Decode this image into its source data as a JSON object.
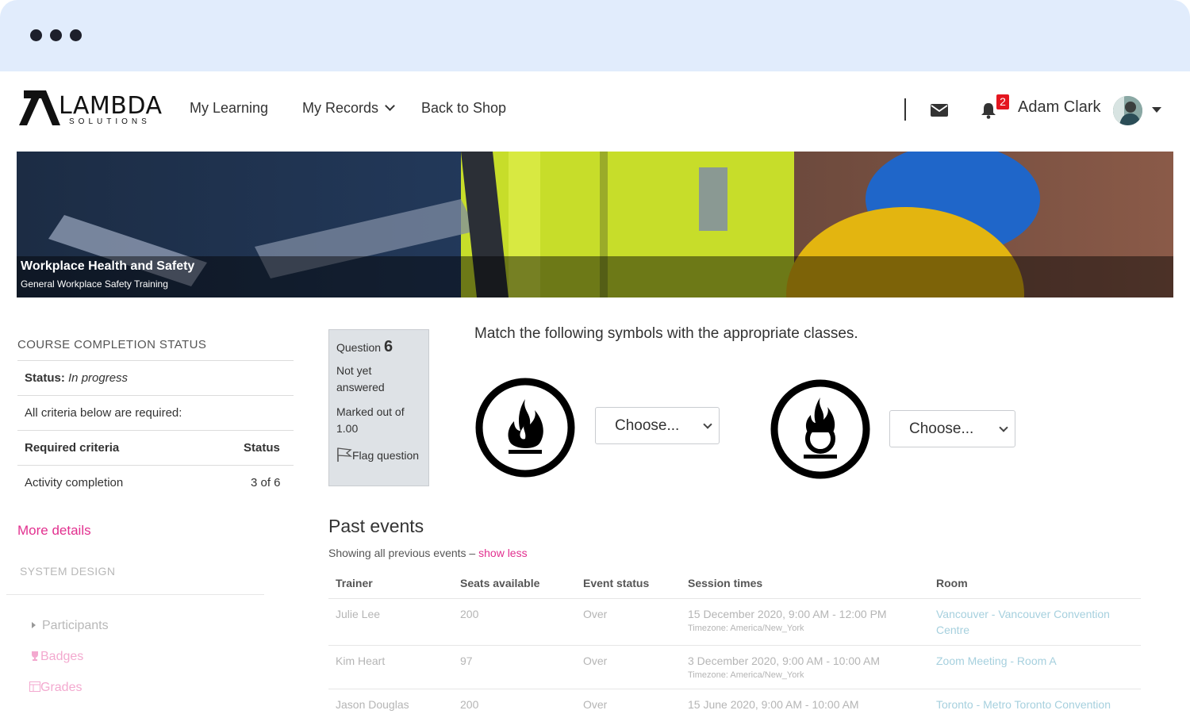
{
  "brand": {
    "word": "LAMBDA",
    "sub": "SOLUTIONS"
  },
  "nav": {
    "my_learning": "My Learning",
    "my_records": "My Records",
    "back_to_shop": "Back to Shop",
    "notification_count": "2",
    "user_name": "Adam Clark"
  },
  "banner": {
    "title": "Workplace Health and Safety",
    "subtitle": "General Workplace Safety Training"
  },
  "completion": {
    "heading": "COURSE COMPLETION STATUS",
    "status_label": "Status:",
    "status_value": "In progress",
    "criteria_note": "All criteria below are required:",
    "col_criteria": "Required criteria",
    "col_status": "Status",
    "row_label": "Activity completion",
    "row_value": "3 of 6",
    "more_details": "More details"
  },
  "sidebar": {
    "section": "SYSTEM DESIGN",
    "items": [
      {
        "label": "Participants",
        "icon": "triangle-right-icon"
      },
      {
        "label": "Badges",
        "icon": "trophy-icon"
      },
      {
        "label": "Grades",
        "icon": "table-icon"
      }
    ]
  },
  "question": {
    "label": "Question",
    "number": "6",
    "state": "Not yet answered",
    "marks": "Marked out of 1.00",
    "flag": "Flag question",
    "prompt": "Match the following symbols with the appropriate classes.",
    "select_1": "Choose...",
    "select_2": "Choose..."
  },
  "events": {
    "title": "Past events",
    "sub_text": "Showing all previous events –",
    "toggle": "show less",
    "columns": [
      "Trainer",
      "Seats available",
      "Event status",
      "Session times",
      "Room"
    ],
    "rows": [
      {
        "trainer": "Julie Lee",
        "seats": "200",
        "status": "Over",
        "time": "15 December 2020, 9:00 AM - 12:00 PM",
        "tz": "Timezone: America/New_York",
        "room_line1": "Vancouver - Vancouver Convention",
        "room_line2": "Centre"
      },
      {
        "trainer": "Kim Heart",
        "seats": "97",
        "status": "Over",
        "time": "3 December 2020, 9:00 AM - 10:00 AM",
        "tz": "Timezone: America/New_York",
        "room_line1": "Zoom Meeting - Room A",
        "room_line2": ""
      },
      {
        "trainer": "Jason Douglas",
        "seats": "200",
        "status": "Over",
        "time": "15 June 2020, 9:00 AM - 10:00 AM",
        "tz": "",
        "room_line1": "Toronto - Metro Toronto Convention",
        "room_line2": ""
      }
    ]
  },
  "colors": {
    "accent": "#e2308f",
    "link_faded": "#a6d0de",
    "chrome": "#e1ecfc"
  }
}
